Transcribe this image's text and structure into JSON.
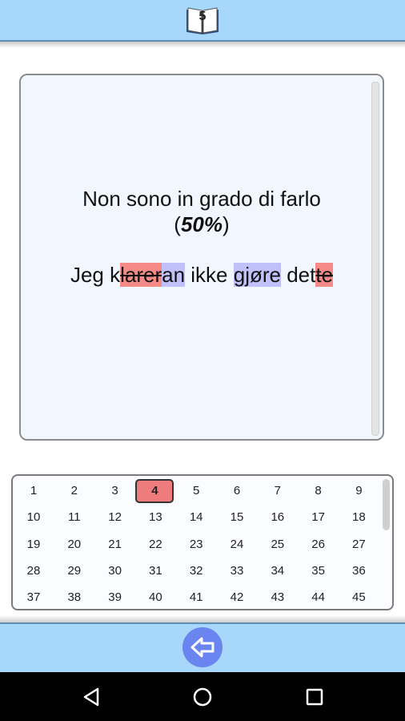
{
  "header": {
    "lesson_number": "5",
    "icon": "book-icon"
  },
  "question": {
    "prompt": "Non sono in grado di farlo",
    "score_open": "(",
    "score_pct": "50%",
    "score_close": ")"
  },
  "answer": {
    "segments": [
      {
        "text": "Jeg k",
        "type": "ok"
      },
      {
        "text": "larer",
        "type": "wrong"
      },
      {
        "text": "an",
        "type": "missing"
      },
      {
        "text": " ikke ",
        "type": "ok"
      },
      {
        "text": "gjøre",
        "type": "missing"
      },
      {
        "text": " det",
        "type": "ok"
      },
      {
        "text": "te",
        "type": "wrong"
      }
    ]
  },
  "grid": {
    "selected": 4,
    "items": [
      "1",
      "2",
      "3",
      "4",
      "5",
      "6",
      "7",
      "8",
      "9",
      "10",
      "11",
      "12",
      "13",
      "14",
      "15",
      "16",
      "17",
      "18",
      "19",
      "20",
      "21",
      "22",
      "23",
      "24",
      "25",
      "26",
      "27",
      "28",
      "29",
      "30",
      "31",
      "32",
      "33",
      "34",
      "35",
      "36",
      "37",
      "38",
      "39",
      "40",
      "41",
      "42",
      "43",
      "44",
      "45"
    ]
  },
  "colors": {
    "bar": "#a7d7fb",
    "wrong": "#f58a86",
    "missing": "#c0c0fa",
    "button": "#6a84f0"
  },
  "footer": {
    "back_icon": "back-arrow-icon"
  },
  "system_nav": [
    "back-triangle-icon",
    "home-circle-icon",
    "recents-square-icon"
  ]
}
